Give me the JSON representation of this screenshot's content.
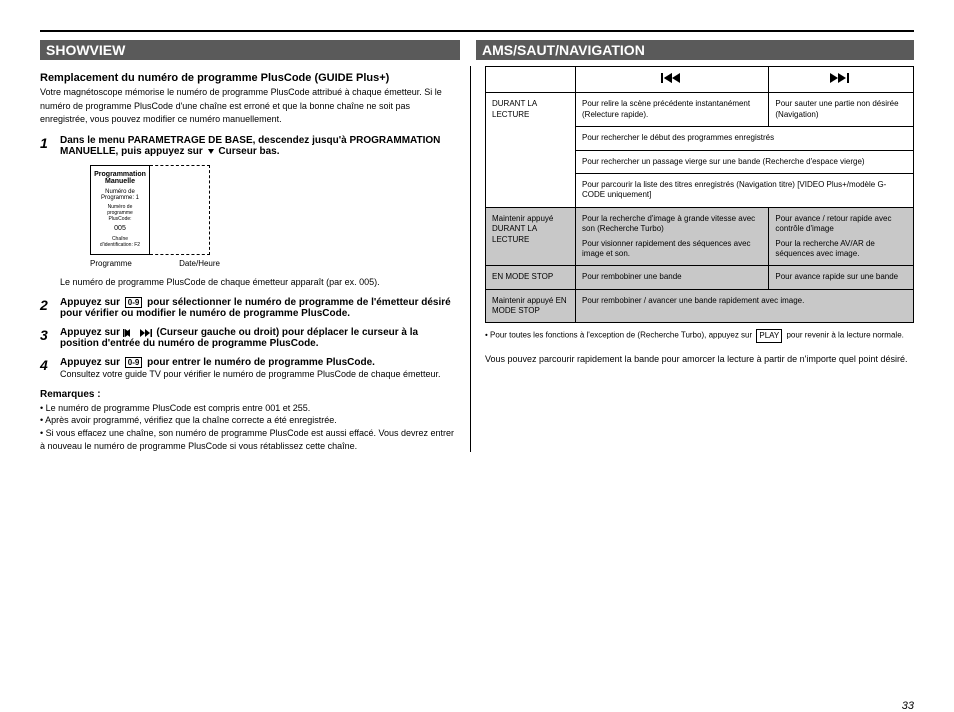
{
  "header": {
    "left_title": "SHOWVIEW",
    "right_title": "AMS/SAUT/NAVIGATION"
  },
  "left": {
    "section1_title": "Remplacement du numéro de programme PlusCode (GUIDE Plus+)",
    "section1_text": "Votre magnétoscope mémorise le numéro de programme PlusCode attribué à chaque émetteur. Si le numéro de programme PlusCode d'une chaîne est erroné et que la bonne chaîne ne soit pas enregistrée, vous pouvez modifier ce numéro manuellement.",
    "step1_bold": "Dans le menu PARAMETRAGE DE BASE, descendez jusqu'à PROGRAMMATION MANUELLE, puis appuyez sur",
    "step1_svg_down_label": "Curseur bas.",
    "caption": {
      "title": "Programmation Manuelle",
      "line1": "Numéro de Programme: 1",
      "line2": "Numéro de programme PlusCode:",
      "line3": "005",
      "line4": "Chaîne d'identification: F2",
      "col_caption_left": "Programme",
      "col_caption_right": "Date/Heure"
    },
    "step1_sub": "Le numéro de programme PlusCode de chaque émetteur apparaît (par ex. 005).",
    "step2_a": "Appuyez sur",
    "step2_box": "0-9",
    "step2_b": "pour sélectionner le numéro de programme de l'émetteur désiré pour vérifier ou modifier le numéro de programme PlusCode.",
    "step3_a": "Appuyez sur",
    "step3_b": "(Curseur gauche ou droit) pour déplacer le curseur à la position d'entrée du numéro de programme PlusCode.",
    "step4_a": "Appuyez sur",
    "step4_box": "0-9",
    "step4_b": "pour entrer le numéro de programme PlusCode.",
    "step4_sub": "Consultez votre guide TV pour vérifier le numéro de programme PlusCode de chaque émetteur.",
    "notes_title": "Remarques :",
    "note1": "Le numéro de programme PlusCode est compris entre 001 et 255.",
    "note2": "Après avoir programmé, vérifiez que la chaîne correcte a été enregistrée.",
    "note3": "Si vous effacez une chaîne, son numéro de programme PlusCode est aussi effacé. Vous devrez entrer à nouveau le numéro de programme PlusCode si vous rétablissez cette chaîne."
  },
  "right": {
    "intro": "Vous pouvez parcourir rapidement la bande pour amorcer la lecture à partir de n'importe quel point désiré.",
    "table": {
      "header_col1": "",
      "header_col2_icon": "prev",
      "header_col3_icon": "next",
      "rows": [
        {
          "c1": "DURANT LA LECTURE",
          "c2": "Pour relire la scène précédente instantanément (Relecture rapide).",
          "c3": "Pour sauter une partie non désirée (Navigation)"
        },
        {
          "c1": "",
          "c2": "Pour rechercher le début des programmes enregistrés",
          "c3": ""
        },
        {
          "c1": "",
          "c2": "Pour rechercher un passage vierge sur une bande (Recherche d'espace vierge)",
          "c3": ""
        },
        {
          "c1": "",
          "c2": "Pour parcourir la liste des titres enregistrés (Navigation titre) [VIDEO Plus+/modèle G-CODE uniquement]",
          "c3": ""
        }
      ],
      "shaded_rows": [
        {
          "c1": "Maintenir appuyé DURANT LA LECTURE",
          "c2": "Pour la recherche d'image à grande vitesse avec son (Recherche Turbo)",
          "c3": "Pour avance / retour rapide avec contrôle d'image",
          "c2b": "Pour visionner rapidement des séquences avec image et son.",
          "c3b": "Pour la recherche AV/AR de séquences avec image."
        },
        {
          "c1": "EN MODE STOP",
          "c2": "Pour rembobiner une bande",
          "c3": "Pour avance rapide sur une bande"
        },
        {
          "c1": "Maintenir appuyé EN MODE STOP",
          "c2": "Pour rembobiner / avancer une bande rapidement avec image.",
          "c3": ""
        }
      ]
    },
    "footer": "Pour toutes les fonctions à l'exception de (Recherche Turbo), appuyez sur PLAY pour revenir à la lecture normale."
  },
  "icons": {
    "play_box": "PLAY"
  },
  "page": "33"
}
